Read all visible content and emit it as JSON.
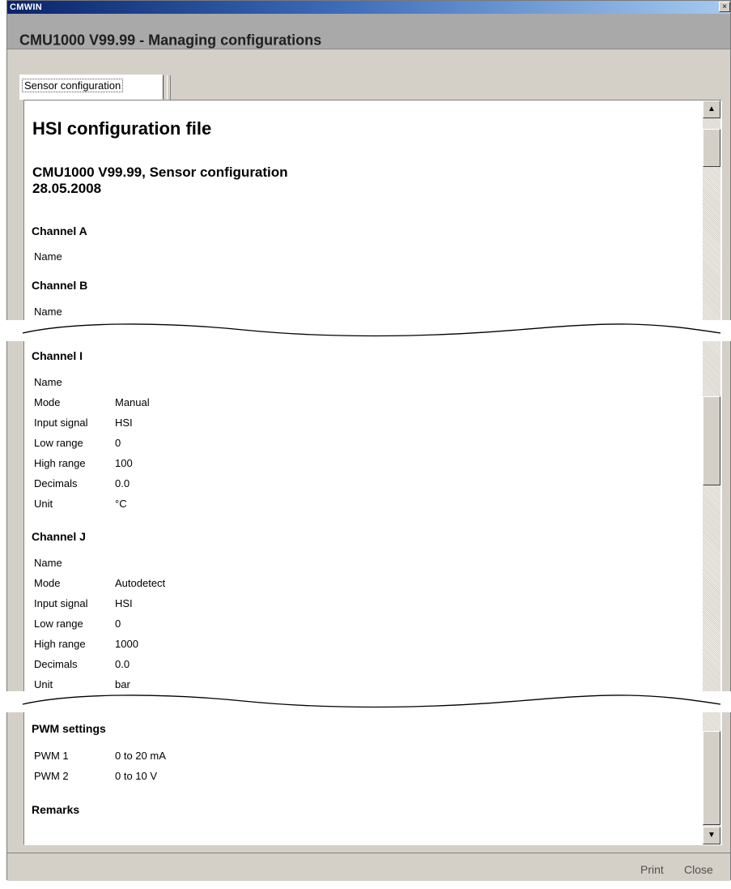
{
  "window": {
    "app_title": "CMWIN",
    "close_glyph": "×",
    "header_title": "CMU1000 V99.99 - Managing configurations"
  },
  "tabs": [
    {
      "label": "Sensor configuration"
    }
  ],
  "document": {
    "title": "HSI configuration file",
    "subtitle_line1": "CMU1000 V99.99, Sensor configuration",
    "subtitle_line2": "28.05.2008",
    "channels": [
      {
        "heading": "Channel A",
        "rows": [
          {
            "label": "Name",
            "value": ""
          }
        ]
      },
      {
        "heading": "Channel B",
        "rows": [
          {
            "label": "Name",
            "value": ""
          }
        ]
      },
      {
        "heading": "Channel I",
        "rows": [
          {
            "label": "Name",
            "value": ""
          },
          {
            "label": "Mode",
            "value": "Manual"
          },
          {
            "label": "Input signal",
            "value": "HSI"
          },
          {
            "label": "Low range",
            "value": "0"
          },
          {
            "label": "High range",
            "value": "100"
          },
          {
            "label": "Decimals",
            "value": "0.0"
          },
          {
            "label": "Unit",
            "value": "°C"
          }
        ]
      },
      {
        "heading": "Channel J",
        "rows": [
          {
            "label": "Name",
            "value": ""
          },
          {
            "label": "Mode",
            "value": "Autodetect"
          },
          {
            "label": "Input signal",
            "value": "HSI"
          },
          {
            "label": "Low range",
            "value": "0"
          },
          {
            "label": "High range",
            "value": "1000"
          },
          {
            "label": "Decimals",
            "value": "0.0"
          },
          {
            "label": "Unit",
            "value": "bar"
          }
        ]
      }
    ],
    "pwm": {
      "heading": "PWM settings",
      "rows": [
        {
          "label": "PWM 1",
          "value": "0 to 20 mA"
        },
        {
          "label": "PWM 2",
          "value": "0 to 10 V"
        }
      ]
    },
    "remarks": {
      "heading": "Remarks"
    }
  },
  "scrollbar": {
    "up_icon": "▲",
    "down_icon": "▼"
  },
  "footer": {
    "print_label": "Print",
    "close_label": "Close"
  }
}
